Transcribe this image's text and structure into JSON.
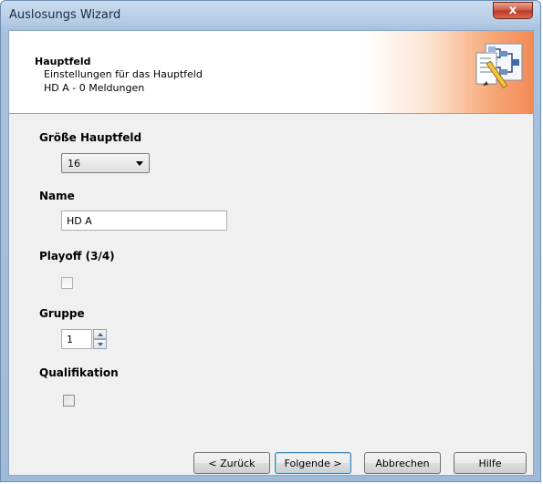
{
  "window": {
    "title": "Auslosungs Wizard",
    "close_glyph": "x"
  },
  "header": {
    "title": "Hauptfeld",
    "subtitle": "Einstellungen für das Hauptfeld",
    "detail": "HD A - 0 Meldungen",
    "icon": "bracket-draw-wizard-icon"
  },
  "form": {
    "size_label": "Größe Hauptfeld",
    "size_value": "16",
    "name_label": "Name",
    "name_value": "HD A",
    "playoff_label": "Playoff (3/4)",
    "playoff_checked": false,
    "group_label": "Gruppe",
    "group_value": "1",
    "qualification_label": "Qualifikation",
    "qualification_checked": false
  },
  "buttons": {
    "back": "< Zurück",
    "next": "Folgende >",
    "cancel": "Abbrechen",
    "help": "Hilfe"
  },
  "colors": {
    "header_accent": "#f28a57",
    "title_bar": "#b7cde6",
    "close_button": "#c0392b"
  }
}
